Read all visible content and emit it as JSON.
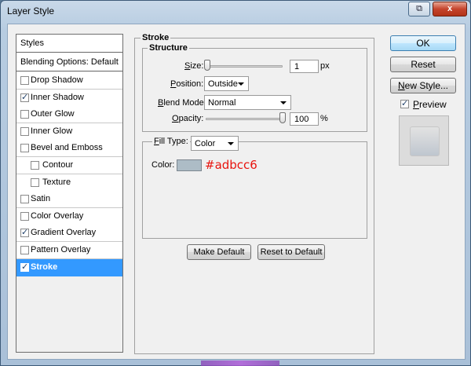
{
  "window": {
    "title": "Layer Style",
    "help_icon": "help-icon",
    "close_label": "x"
  },
  "styles_panel": {
    "header": "Styles",
    "blending_options": "Blending Options: Default",
    "items": [
      {
        "label": "Drop Shadow",
        "checked": false
      },
      {
        "label": "Inner Shadow",
        "checked": true
      },
      {
        "label": "Outer Glow",
        "checked": false
      },
      {
        "label": "Inner Glow",
        "checked": false
      },
      {
        "label": "Bevel and Emboss",
        "checked": false
      },
      {
        "label": "Contour",
        "checked": false,
        "indent": true
      },
      {
        "label": "Texture",
        "checked": false,
        "indent": true
      },
      {
        "label": "Satin",
        "checked": false
      },
      {
        "label": "Color Overlay",
        "checked": false
      },
      {
        "label": "Gradient Overlay",
        "checked": true
      },
      {
        "label": "Pattern Overlay",
        "checked": false
      },
      {
        "label": "Stroke",
        "checked": true,
        "active": true
      }
    ]
  },
  "stroke": {
    "title": "Stroke",
    "structure": {
      "title": "Structure",
      "size_label": "Size:",
      "size_value": "1",
      "size_unit": "px",
      "size_fraction": 0.0,
      "position_label": "Position:",
      "position_value": "Outside",
      "blend_label": "Blend Mode:",
      "blend_value": "Normal",
      "opacity_label": "Opacity:",
      "opacity_value": "100",
      "opacity_unit": "%",
      "opacity_fraction": 1.0
    },
    "fill": {
      "fill_type_label": "Fill Type:",
      "fill_type_value": "Color",
      "color_label": "Color:",
      "color_hex": "#adbcc6",
      "color_text": "#adbcc6"
    },
    "make_default": "Make Default",
    "reset_default": "Reset to Default"
  },
  "actions": {
    "ok": "OK",
    "reset": "Reset",
    "new_style": "New Style...",
    "preview_label": "Preview",
    "preview_checked": true
  },
  "colors": {
    "active_row": "#3399ff",
    "swatch": "#adbcc6",
    "hex_text": "#e8140e"
  }
}
